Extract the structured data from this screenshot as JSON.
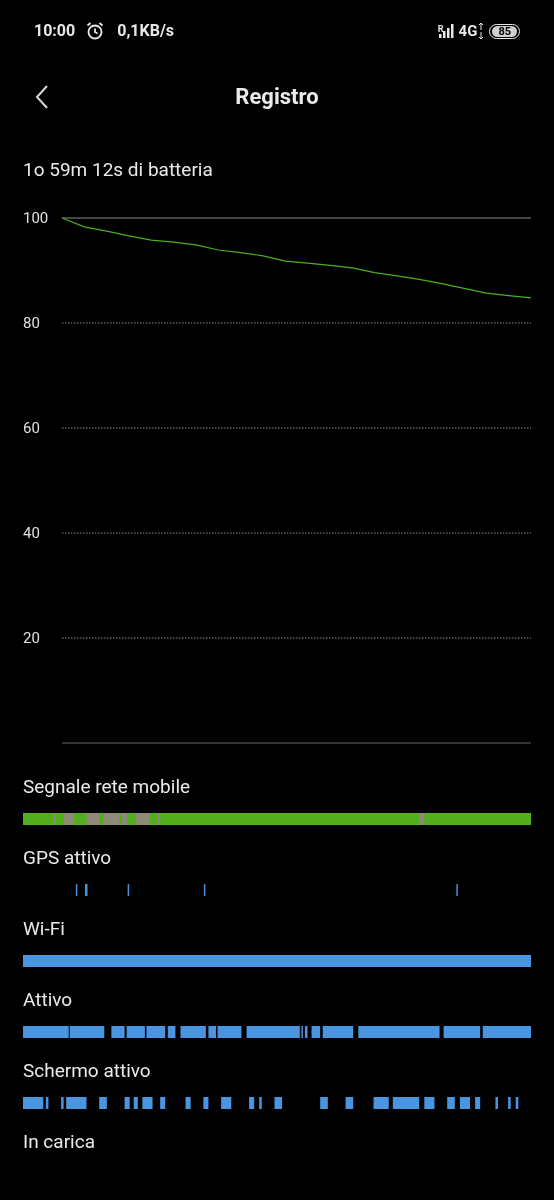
{
  "status_bar": {
    "time": "10:00",
    "speed": "0,1KB/s",
    "roaming": "R",
    "network": "4G",
    "battery": "85"
  },
  "header": {
    "title": "Registro"
  },
  "summary": "1o 59m 12s di batteria",
  "chart": {
    "chart_data": {
      "type": "line",
      "ylim": [
        0,
        100
      ],
      "yticks": [
        20,
        40,
        60,
        80,
        100
      ],
      "grid": true,
      "series": [
        {
          "color": "#4caf1e",
          "values": [
            100,
            98.3,
            97.5,
            96.6,
            95.8,
            95.4,
            94.9,
            93.9,
            93.4,
            92.8,
            91.8,
            91.4,
            91,
            90.5,
            89.6,
            89,
            88.3,
            87.5,
            86.6,
            85.7,
            85.2,
            84.8
          ]
        }
      ]
    }
  },
  "tracks": [
    {
      "label": "Segnale rete mobile",
      "kind": "signal"
    },
    {
      "label": "GPS attivo",
      "kind": "sparse"
    },
    {
      "label": "Wi-Fi",
      "kind": "full"
    },
    {
      "label": "Attivo",
      "kind": "dense"
    },
    {
      "label": "Schermo attivo",
      "kind": "screen"
    },
    {
      "label": "In carica",
      "kind": "none"
    }
  ]
}
